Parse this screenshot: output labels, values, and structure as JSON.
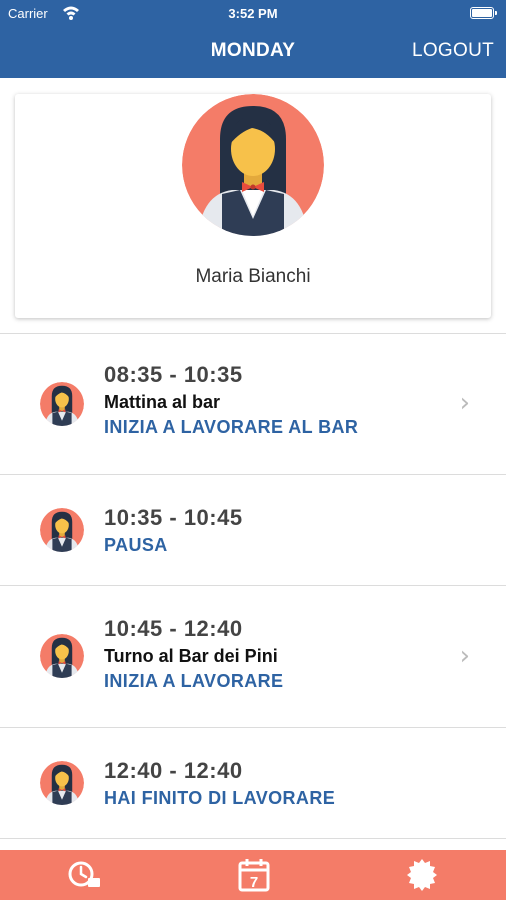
{
  "status_bar": {
    "carrier": "Carrier",
    "time": "3:52 PM",
    "icons": [
      "wifi-icon",
      "battery-icon"
    ]
  },
  "header": {
    "title": "MONDAY",
    "logout_label": "LOGOUT",
    "background": "#2e63a3"
  },
  "profile": {
    "name": "Maria Bianchi",
    "avatar_icon": "waitress-avatar-icon",
    "avatar_color": "#f47c68"
  },
  "schedule": [
    {
      "time": "08:35 - 10:35",
      "description": "Mattina al bar",
      "action": "INIZIA A LAVORARE AL BAR",
      "has_chevron": true
    },
    {
      "time": "10:35 - 10:45",
      "description": "",
      "action": "PAUSA",
      "has_chevron": false
    },
    {
      "time": "10:45 - 12:40",
      "description": "Turno al Bar dei Pini",
      "action": "INIZIA A LAVORARE",
      "has_chevron": true
    },
    {
      "time": "12:40 - 12:40",
      "description": "",
      "action": "HAI FINITO DI LAVORARE",
      "has_chevron": false
    }
  ],
  "tabbar": {
    "tabs": [
      "clock-icon",
      "calendar-icon",
      "badge-icon"
    ],
    "calendar_day": "7",
    "background": "#f47c68"
  },
  "colors": {
    "accent": "#2e63a3",
    "avatar_bg": "#f47c68",
    "vest": "#2f3d55",
    "hair": "#243044",
    "skin": "#f7c14a",
    "bowtie": "#e84c3d"
  }
}
